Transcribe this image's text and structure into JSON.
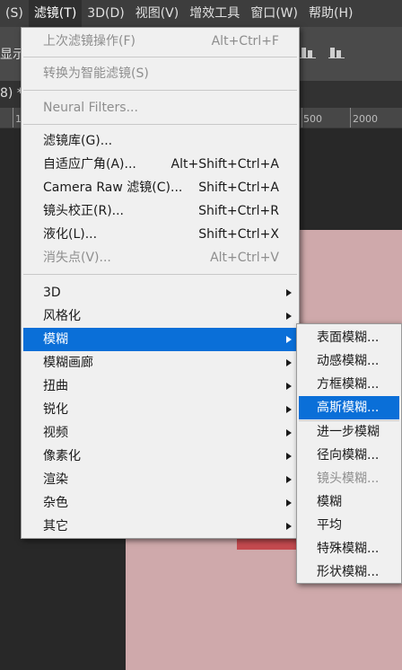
{
  "menubar": {
    "items": [
      "(S)",
      "滤镜(T)",
      "3D(D)",
      "视图(V)",
      "增效工具",
      "窗口(W)",
      "帮助(H)"
    ]
  },
  "options_bar": {
    "label_fragment": "显示"
  },
  "tab": {
    "title_fragment": "8) *"
  },
  "ruler": {
    "ticks": [
      "1",
      "500",
      "2000"
    ]
  },
  "filter_menu": {
    "items": [
      {
        "label": "上次滤镜操作(F)",
        "shortcut": "Alt+Ctrl+F",
        "disabled": true
      },
      {
        "label": "转换为智能滤镜(S)",
        "disabled": true
      },
      {
        "label": "Neural Filters...",
        "disabled": true
      },
      {
        "label": "滤镜库(G)..."
      },
      {
        "label": "自适应广角(A)...",
        "shortcut": "Alt+Shift+Ctrl+A"
      },
      {
        "label": "Camera Raw 滤镜(C)...",
        "shortcut": "Shift+Ctrl+A"
      },
      {
        "label": "镜头校正(R)...",
        "shortcut": "Shift+Ctrl+R"
      },
      {
        "label": "液化(L)...",
        "shortcut": "Shift+Ctrl+X"
      },
      {
        "label": "消失点(V)...",
        "shortcut": "Alt+Ctrl+V",
        "disabled": true
      },
      {
        "label": "3D",
        "submenu": true
      },
      {
        "label": "风格化",
        "submenu": true
      },
      {
        "label": "模糊",
        "submenu": true,
        "highlighted": true
      },
      {
        "label": "模糊画廊",
        "submenu": true
      },
      {
        "label": "扭曲",
        "submenu": true
      },
      {
        "label": "锐化",
        "submenu": true
      },
      {
        "label": "视频",
        "submenu": true
      },
      {
        "label": "像素化",
        "submenu": true
      },
      {
        "label": "渲染",
        "submenu": true
      },
      {
        "label": "杂色",
        "submenu": true
      },
      {
        "label": "其它",
        "submenu": true
      }
    ]
  },
  "blur_submenu": {
    "items": [
      {
        "label": "表面模糊..."
      },
      {
        "label": "动感模糊..."
      },
      {
        "label": "方框模糊..."
      },
      {
        "label": "高斯模糊...",
        "highlighted": true
      },
      {
        "label": "进一步模糊"
      },
      {
        "label": "径向模糊..."
      },
      {
        "label": "镜头模糊...",
        "disabled": true
      },
      {
        "label": "模糊"
      },
      {
        "label": "平均"
      },
      {
        "label": "特殊模糊..."
      },
      {
        "label": "形状模糊..."
      }
    ]
  },
  "colors": {
    "highlight": "#0a6fd8",
    "menu_bg": "#f0f0f0",
    "canvas": "#cfa9ab",
    "red_shape": "#c44a4f"
  }
}
